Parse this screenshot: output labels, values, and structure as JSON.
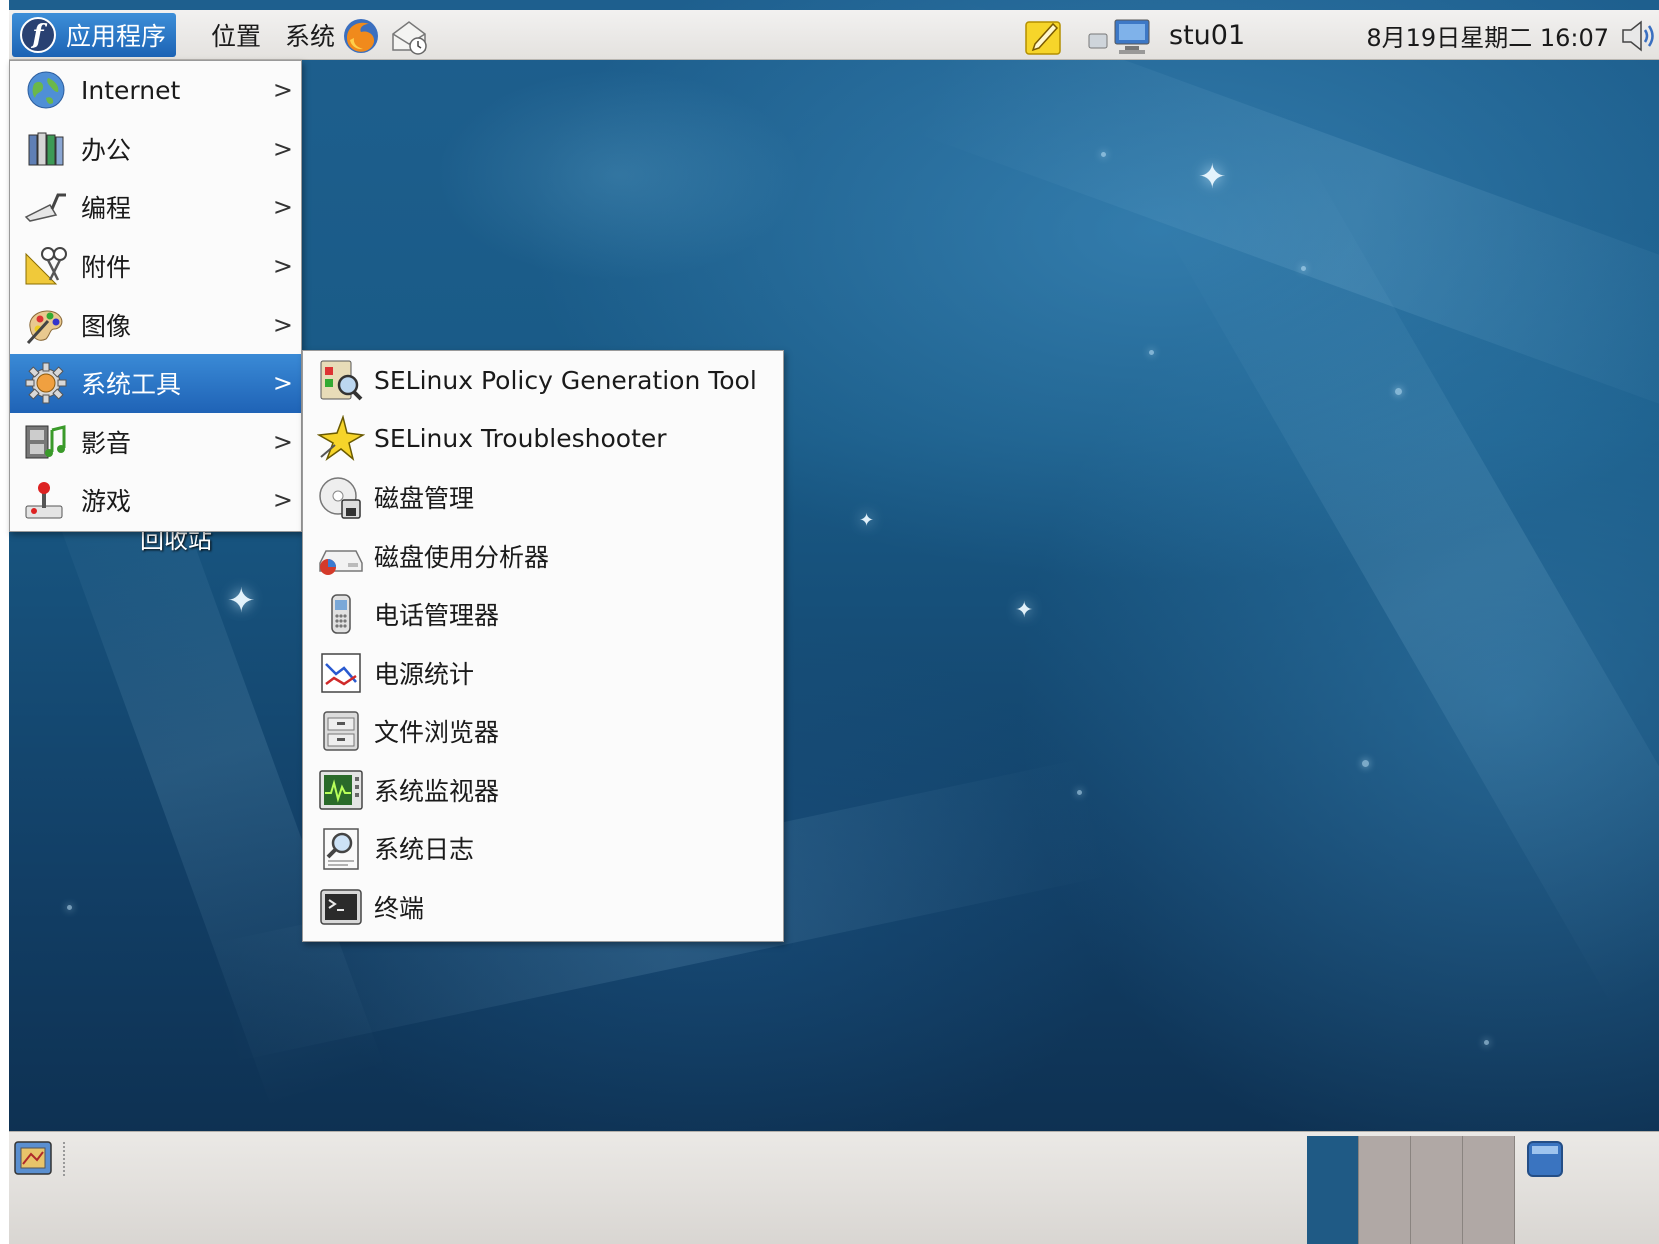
{
  "top_panel": {
    "apps_label": "应用程序",
    "places_label": "位置",
    "system_label": "系统",
    "user": "stu01",
    "clock": "8月19日星期二 16:07"
  },
  "apps_menu": {
    "items": [
      {
        "label": "Internet",
        "icon": "globe-icon"
      },
      {
        "label": "办公",
        "icon": "office-icon"
      },
      {
        "label": "编程",
        "icon": "trowel-icon"
      },
      {
        "label": "附件",
        "icon": "accessories-icon"
      },
      {
        "label": "图像",
        "icon": "palette-icon"
      },
      {
        "label": "系统工具",
        "icon": "gear-icon"
      },
      {
        "label": "影音",
        "icon": "film-icon"
      },
      {
        "label": "游戏",
        "icon": "joystick-icon"
      }
    ],
    "active_index": 5
  },
  "system_tools_menu": {
    "items": [
      {
        "label": "SELinux Policy Generation Tool",
        "icon": "policy-tool-icon"
      },
      {
        "label": "SELinux Troubleshooter",
        "icon": "star-icon"
      },
      {
        "label": "磁盘管理",
        "icon": "disk-icon"
      },
      {
        "label": "磁盘使用分析器",
        "icon": "disk-usage-icon"
      },
      {
        "label": "电话管理器",
        "icon": "phone-icon"
      },
      {
        "label": "电源统计",
        "icon": "power-stats-icon"
      },
      {
        "label": "文件浏览器",
        "icon": "file-cabinet-icon"
      },
      {
        "label": "系统监视器",
        "icon": "monitor-icon"
      },
      {
        "label": "系统日志",
        "icon": "log-icon"
      },
      {
        "label": "终端",
        "icon": "terminal-icon"
      }
    ]
  },
  "colors": {
    "highlight": "#2a74c6",
    "panel": "#e8e6e3",
    "desktop": "#1a5683"
  }
}
